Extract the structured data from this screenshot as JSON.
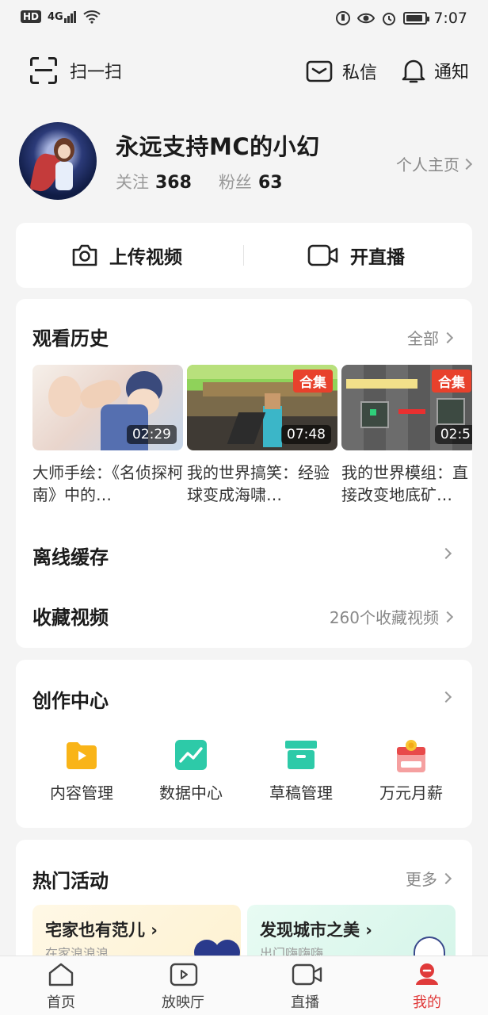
{
  "status_bar": {
    "left_badge": "HD",
    "signal": "4G",
    "time": "7:07",
    "battery_level": 0.9
  },
  "topbar": {
    "scan_label": "扫一扫",
    "messages_label": "私信",
    "notifications_label": "通知"
  },
  "profile": {
    "username": "永远支持MC的小幻",
    "following_label": "关注",
    "following_count": "368",
    "fans_label": "粉丝",
    "fans_count": "63",
    "homepage_label": "个人主页"
  },
  "actions": {
    "upload_label": "上传视频",
    "live_label": "开直播"
  },
  "history": {
    "title": "观看历史",
    "more_label": "全部",
    "videos": [
      {
        "title": "大师手绘：《名侦探柯南》中的…",
        "duration": "02:29",
        "badge": ""
      },
      {
        "title": "我的世界搞笑：经验球变成海啸…",
        "duration": "07:48",
        "badge": "合集"
      },
      {
        "title": "我的世界模组：直接改变地底矿…",
        "duration": "02:5",
        "badge": "合集"
      }
    ],
    "offline_label": "离线缓存",
    "favorites_label": "收藏视频",
    "favorites_count": "260个收藏视频"
  },
  "creator": {
    "title": "创作中心",
    "tools": [
      {
        "label": "内容管理",
        "icon": "folder-play-icon",
        "color": "#f9b418"
      },
      {
        "label": "数据中心",
        "icon": "chart-icon",
        "color": "#2dcaa8"
      },
      {
        "label": "草稿管理",
        "icon": "archive-box-icon",
        "color": "#2dcaa8"
      },
      {
        "label": "万元月薪",
        "icon": "reward-calendar-icon",
        "color": "#e84a4a"
      }
    ]
  },
  "events": {
    "title": "热门活动",
    "more_label": "更多",
    "banners": [
      {
        "title": "宅家也有范儿",
        "subtitle": "在家浪浪浪"
      },
      {
        "title": "发现城市之美",
        "subtitle": "出门嗨嗨嗨"
      }
    ]
  },
  "tabbar": {
    "items": [
      {
        "label": "首页",
        "icon": "home-icon",
        "active": false
      },
      {
        "label": "放映厅",
        "icon": "play-screen-icon",
        "active": false
      },
      {
        "label": "直播",
        "icon": "live-camera-icon",
        "active": false
      },
      {
        "label": "我的",
        "icon": "profile-icon",
        "active": true
      }
    ],
    "active_color": "#e03a3a"
  }
}
